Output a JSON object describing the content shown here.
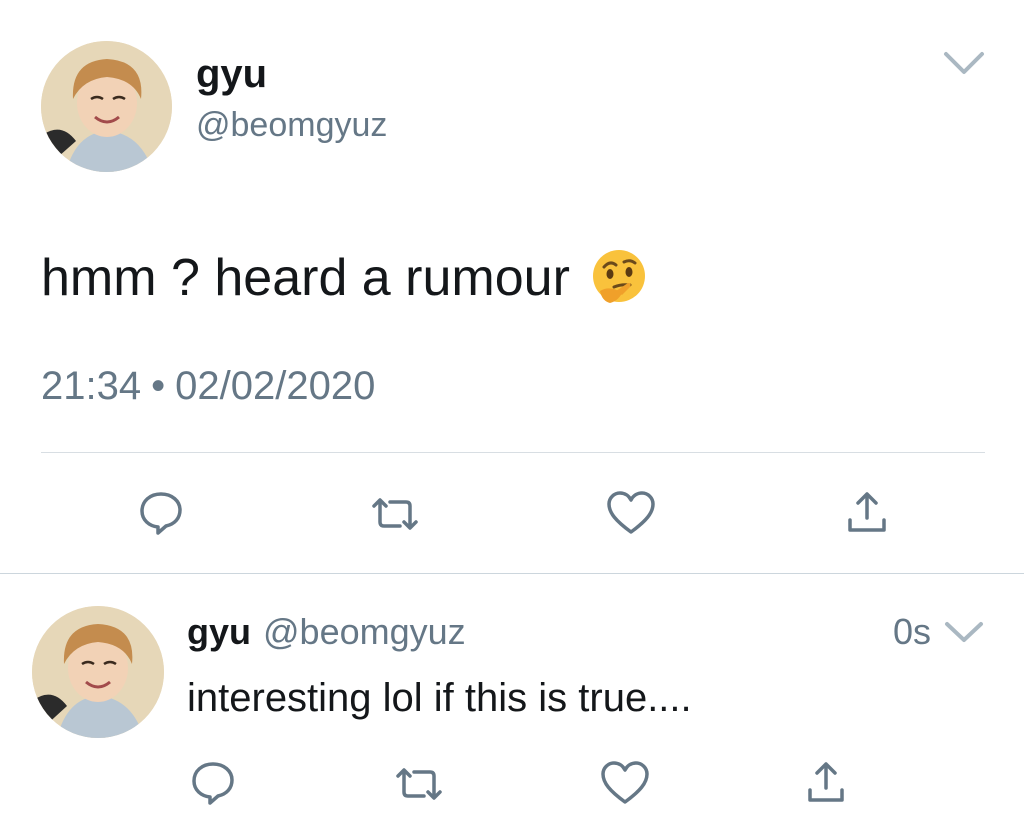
{
  "main_tweet": {
    "display_name": "gyu",
    "handle": "@beomgyuz",
    "text": "hmm ? heard a rumour",
    "emoji": "thinking-face",
    "time": "21:34",
    "separator": "•",
    "date": "02/02/2020"
  },
  "reply_tweet": {
    "display_name": "gyu",
    "handle": "@beomgyuz",
    "relative_time": "0s",
    "text": "interesting lol if this is true...."
  },
  "icons": {
    "caret": "chevron-down-icon",
    "reply": "speech-bubble-icon",
    "retweet": "retweet-arrows-icon",
    "like": "heart-icon",
    "share": "share-upload-icon"
  },
  "colors": {
    "text": "#14171a",
    "secondary": "#657786",
    "divider": "#d8dee3",
    "icon": "#657786"
  }
}
